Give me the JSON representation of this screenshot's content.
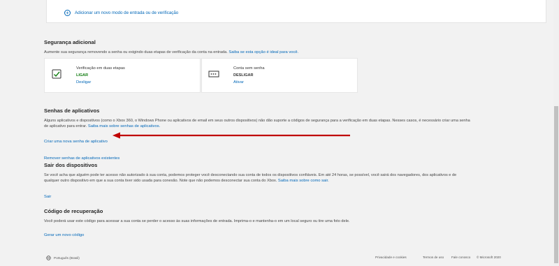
{
  "top": {
    "add_label": "Adicionar um novo modo de entrada ou de verificação"
  },
  "security": {
    "title": "Segurança adicional",
    "desc": "Aumente sua segurança removendo a senha ou exigindo duas etapas de verificação da conta na entrada.",
    "desc_link": "Saiba se esta opção é ideal para você.",
    "cards": [
      {
        "title": "Verificação em duas etapas",
        "status": "LIGAR",
        "action": "Desligar",
        "icon": "shield-check-icon"
      },
      {
        "title": "Conta sem senha",
        "status": "DESLIGAR",
        "action": "Ativar",
        "icon": "password-box-icon"
      }
    ]
  },
  "app_passwords": {
    "title": "Senhas de aplicativos",
    "desc1": "Alguns aplicativos e dispositivos (como o Xbox 360, o Windows Phone ou aplicativos de email em seus outros dispositivos) não dão suporte a códigos de segurança para a verificação em duas etapas. Nesses casos, é necessário criar uma senha",
    "desc2": "de aplicativo para entrar.",
    "desc_link": "Saiba mais sobre senhas de aplicativos.",
    "create_link": "Criar uma nova senha de aplicativo",
    "remove_link": "Remover senhas de aplicativos existentes"
  },
  "signout": {
    "title": "Sair dos dispositivos",
    "desc1": "Se você acha que alguém pode ter acesso não autorizado à sua conta, podemos proteger você desconectando sua conta de todos os dispositivos confiáveis. Em até 24 horas, se possível, você sairá dos navegadores, dos aplicativos e de",
    "desc2": "qualquer outro dispositivo em que a sua conta tiver sido usada para conexão. Note que não podemos desconectar sua conta do Xbox.",
    "desc_link": "Saiba mais sobre como sair.",
    "action": "Sair"
  },
  "recovery": {
    "title": "Código de recuperação",
    "desc": "Você poderá usar este código para acessar a sua conta se perder o acesso às suas informações de entrada. Imprima-o e mantenha-o em um local seguro ou tire uma foto dele.",
    "action": "Gerar um novo código"
  },
  "footer": {
    "language": "Português (Brasil)",
    "links": [
      "Privacidade e cookies",
      "Termos de uso",
      "Fale conosco",
      "© Microsoft 2020"
    ]
  },
  "colors": {
    "accent": "#0067b8",
    "on": "#107c10",
    "arrow": "#c00000"
  }
}
